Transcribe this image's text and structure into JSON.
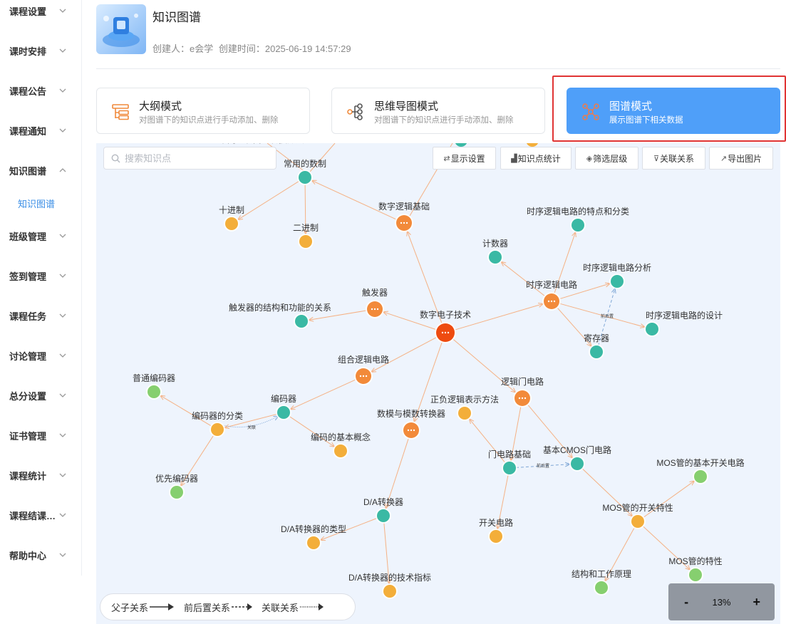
{
  "sidebar": {
    "items": [
      {
        "label": "课程设置",
        "chevron": "down"
      },
      {
        "label": "课时安排",
        "chevron": "down"
      },
      {
        "label": "课程公告",
        "chevron": "down"
      },
      {
        "label": "课程通知",
        "chevron": "down"
      },
      {
        "label": "知识图谱",
        "chevron": "up"
      },
      {
        "label": "班级管理",
        "chevron": "down"
      },
      {
        "label": "签到管理",
        "chevron": "down"
      },
      {
        "label": "课程任务",
        "chevron": "down"
      },
      {
        "label": "讨论管理",
        "chevron": "down"
      },
      {
        "label": "总分设置",
        "chevron": "down"
      },
      {
        "label": "证书管理",
        "chevron": "down"
      },
      {
        "label": "课程统计",
        "chevron": "down"
      },
      {
        "label": "课程结课…",
        "chevron": "down"
      },
      {
        "label": "帮助中心",
        "chevron": "down"
      }
    ],
    "sub_item": "知识图谱"
  },
  "header": {
    "title": "知识图谱",
    "creator": "创建人：e会学",
    "created": "创建时间：2025-06-19 14:57:29"
  },
  "modes": [
    {
      "title": "大纲模式",
      "desc": "对图谱下的知识点进行手动添加、删除",
      "icon": "outline-tree-icon",
      "active": false
    },
    {
      "title": "思维导图模式",
      "desc": "对图谱下的知识点进行手动添加、删除",
      "icon": "mindmap-icon",
      "active": false
    },
    {
      "title": "图谱模式",
      "desc": "展示图谱下相关数据",
      "icon": "graph-network-icon",
      "active": true
    }
  ],
  "colors": {
    "accent": "#4f9ff9",
    "highlight_border": "#e03434",
    "root_node": "#ee4b10",
    "hub_node": "#f28a3a",
    "leaf_orange": "#f3ae3a",
    "leaf_teal": "#3ab9a4",
    "leaf_green": "#86cf6f",
    "edge": "#f5b184",
    "graph_bg": "#eef4fd"
  },
  "toolbar": {
    "search_placeholder": "搜索知识点",
    "buttons": [
      {
        "label": "显示设置",
        "icon": "swap-icon"
      },
      {
        "label": "知识点统计",
        "icon": "bar-chart-icon"
      },
      {
        "label": "筛选层级",
        "icon": "layers-icon"
      },
      {
        "label": "关联关系",
        "icon": "filter-icon"
      },
      {
        "label": "导出图片",
        "icon": "export-icon"
      }
    ]
  },
  "graph": {
    "partial_top_label": "不同进制间的转换方法",
    "nodes": [
      {
        "id": "root",
        "label": "数字电子技术",
        "type": "root"
      },
      {
        "id": "sz",
        "label": "数字逻辑基础",
        "type": "hub"
      },
      {
        "id": "cy",
        "label": "常用的数制",
        "type": "teal"
      },
      {
        "id": "sjz",
        "label": "十进制",
        "type": "orange"
      },
      {
        "id": "ejz",
        "label": "二进制",
        "type": "orange"
      },
      {
        "id": "cfq",
        "label": "触发器",
        "type": "hub"
      },
      {
        "id": "cfqjg",
        "label": "触发器的结构和功能的关系",
        "type": "teal"
      },
      {
        "id": "sx",
        "label": "时序逻辑电路",
        "type": "hub"
      },
      {
        "id": "jsq",
        "label": "计数器",
        "type": "teal"
      },
      {
        "id": "sxtd",
        "label": "时序逻辑电路的特点和分类",
        "type": "teal"
      },
      {
        "id": "sxfx",
        "label": "时序逻辑电路分析",
        "type": "teal"
      },
      {
        "id": "sxsj",
        "label": "时序逻辑电路的设计",
        "type": "teal"
      },
      {
        "id": "jcq",
        "label": "寄存器",
        "type": "teal"
      },
      {
        "id": "zh",
        "label": "组合逻辑电路",
        "type": "hub"
      },
      {
        "id": "bmq",
        "label": "编码器",
        "type": "teal"
      },
      {
        "id": "bmfl",
        "label": "编码器的分类",
        "type": "orange"
      },
      {
        "id": "ptbm",
        "label": "普通编码器",
        "type": "green"
      },
      {
        "id": "yxbm",
        "label": "优先编码器",
        "type": "green"
      },
      {
        "id": "bmgn",
        "label": "编码的基本概念",
        "type": "orange"
      },
      {
        "id": "ljm",
        "label": "逻辑门电路",
        "type": "hub"
      },
      {
        "id": "zf",
        "label": "正负逻辑表示方法",
        "type": "orange"
      },
      {
        "id": "mdj",
        "label": "门电路基础",
        "type": "teal"
      },
      {
        "id": "cmos",
        "label": "基本CMOS门电路",
        "type": "teal"
      },
      {
        "id": "kg",
        "label": "开关电路",
        "type": "orange"
      },
      {
        "id": "mosk",
        "label": "MOS管的开关特性",
        "type": "orange"
      },
      {
        "id": "mosjb",
        "label": "MOS管的基本开关电路",
        "type": "green"
      },
      {
        "id": "mostx",
        "label": "MOS管的特性",
        "type": "green"
      },
      {
        "id": "jg",
        "label": "结构和工作原理",
        "type": "green"
      },
      {
        "id": "smz",
        "label": "数模与模数转换器",
        "type": "hub"
      },
      {
        "id": "da",
        "label": "D/A转换器",
        "type": "teal"
      },
      {
        "id": "dalx",
        "label": "D/A转换器的类型",
        "type": "orange"
      },
      {
        "id": "dajs",
        "label": "D/A转换器的技术指标",
        "type": "orange"
      }
    ],
    "edge_labels": {
      "prerequisite": "前后置",
      "association": "关联"
    }
  },
  "legend": [
    {
      "label": "父子关系",
      "style": "solid"
    },
    {
      "label": "前后置关系",
      "style": "dashed"
    },
    {
      "label": "关联关系",
      "style": "dotted"
    }
  ],
  "zoom": {
    "minus": "-",
    "value": "13%",
    "plus": "+"
  }
}
